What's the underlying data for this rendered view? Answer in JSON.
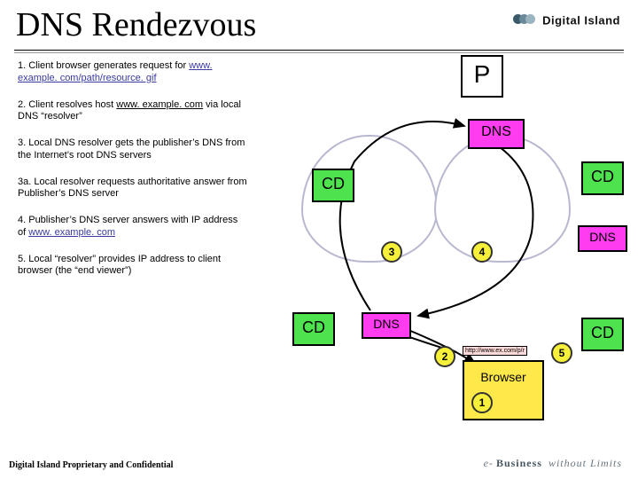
{
  "title": "DNS Rendezvous",
  "brand": {
    "name": "Digital Island",
    "tagline_pre": "e-",
    "tagline_strong": "Business",
    "tagline_post": " without Limits"
  },
  "steps": {
    "s1a": "1. Client browser generates request for ",
    "s1_link": "www. example. com/path/resource. gif",
    "s2a": "2. Client resolves host ",
    "s2_host": "www. example. com",
    "s2b": " via local DNS “resolver”",
    "s3": "3. Local DNS resolver gets the publisher’s DNS from the Internet’s root DNS servers",
    "s3a": "3a. Local resolver requests authoritative answer from Publisher’s DNS server",
    "s4a": "4. Publisher’s DNS server answers with IP address of ",
    "s4_link": "www. example. com",
    "s5": "5. Local “resolver” provides IP address to client browser (the “end viewer”)"
  },
  "diagram": {
    "p": "P",
    "cd": "CD",
    "dns": "DNS",
    "browser": "Browser",
    "url": "http://www.ex.com/p/r",
    "n1": "1",
    "n2": "2",
    "n3": "3",
    "n4": "4",
    "n5": "5"
  },
  "footer": {
    "proprietary": "Digital Island Proprietary and Confidential"
  }
}
